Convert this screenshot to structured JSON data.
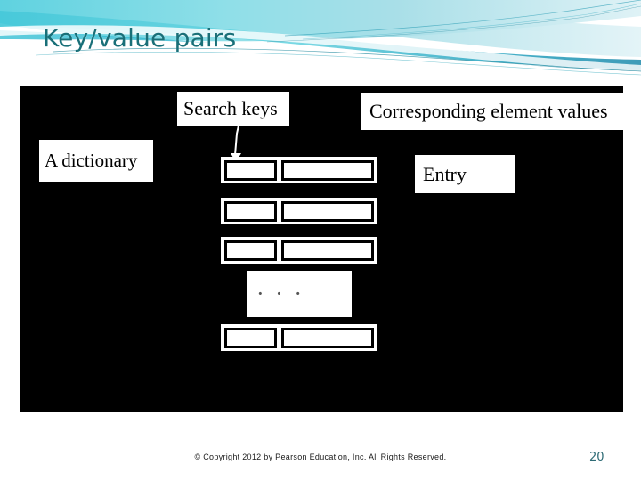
{
  "slide": {
    "title": "Key/value pairs",
    "page_number": "20",
    "copyright": "© Copyright 2012 by Pearson Education, Inc. All Rights Reserved."
  },
  "theme": {
    "title_color": "#196f78",
    "accent_color": "#3fc6d8",
    "banner_dark": "#2aa7bd",
    "banner_light": "#bfe7ee",
    "diagram_bg": "#000000",
    "chip_bg": "#ffffff",
    "chip_text": "#000000"
  },
  "diagram": {
    "captions": {
      "search_keys": "Search keys",
      "corresponding_values": "Corresponding element values",
      "a_dictionary": "A dictionary",
      "entry": "Entry"
    },
    "ellipsis": "· · ·",
    "rows": [
      {
        "key": "",
        "value": ""
      },
      {
        "key": "",
        "value": ""
      },
      {
        "key": "",
        "value": ""
      },
      {
        "key": "",
        "value": ""
      }
    ]
  }
}
